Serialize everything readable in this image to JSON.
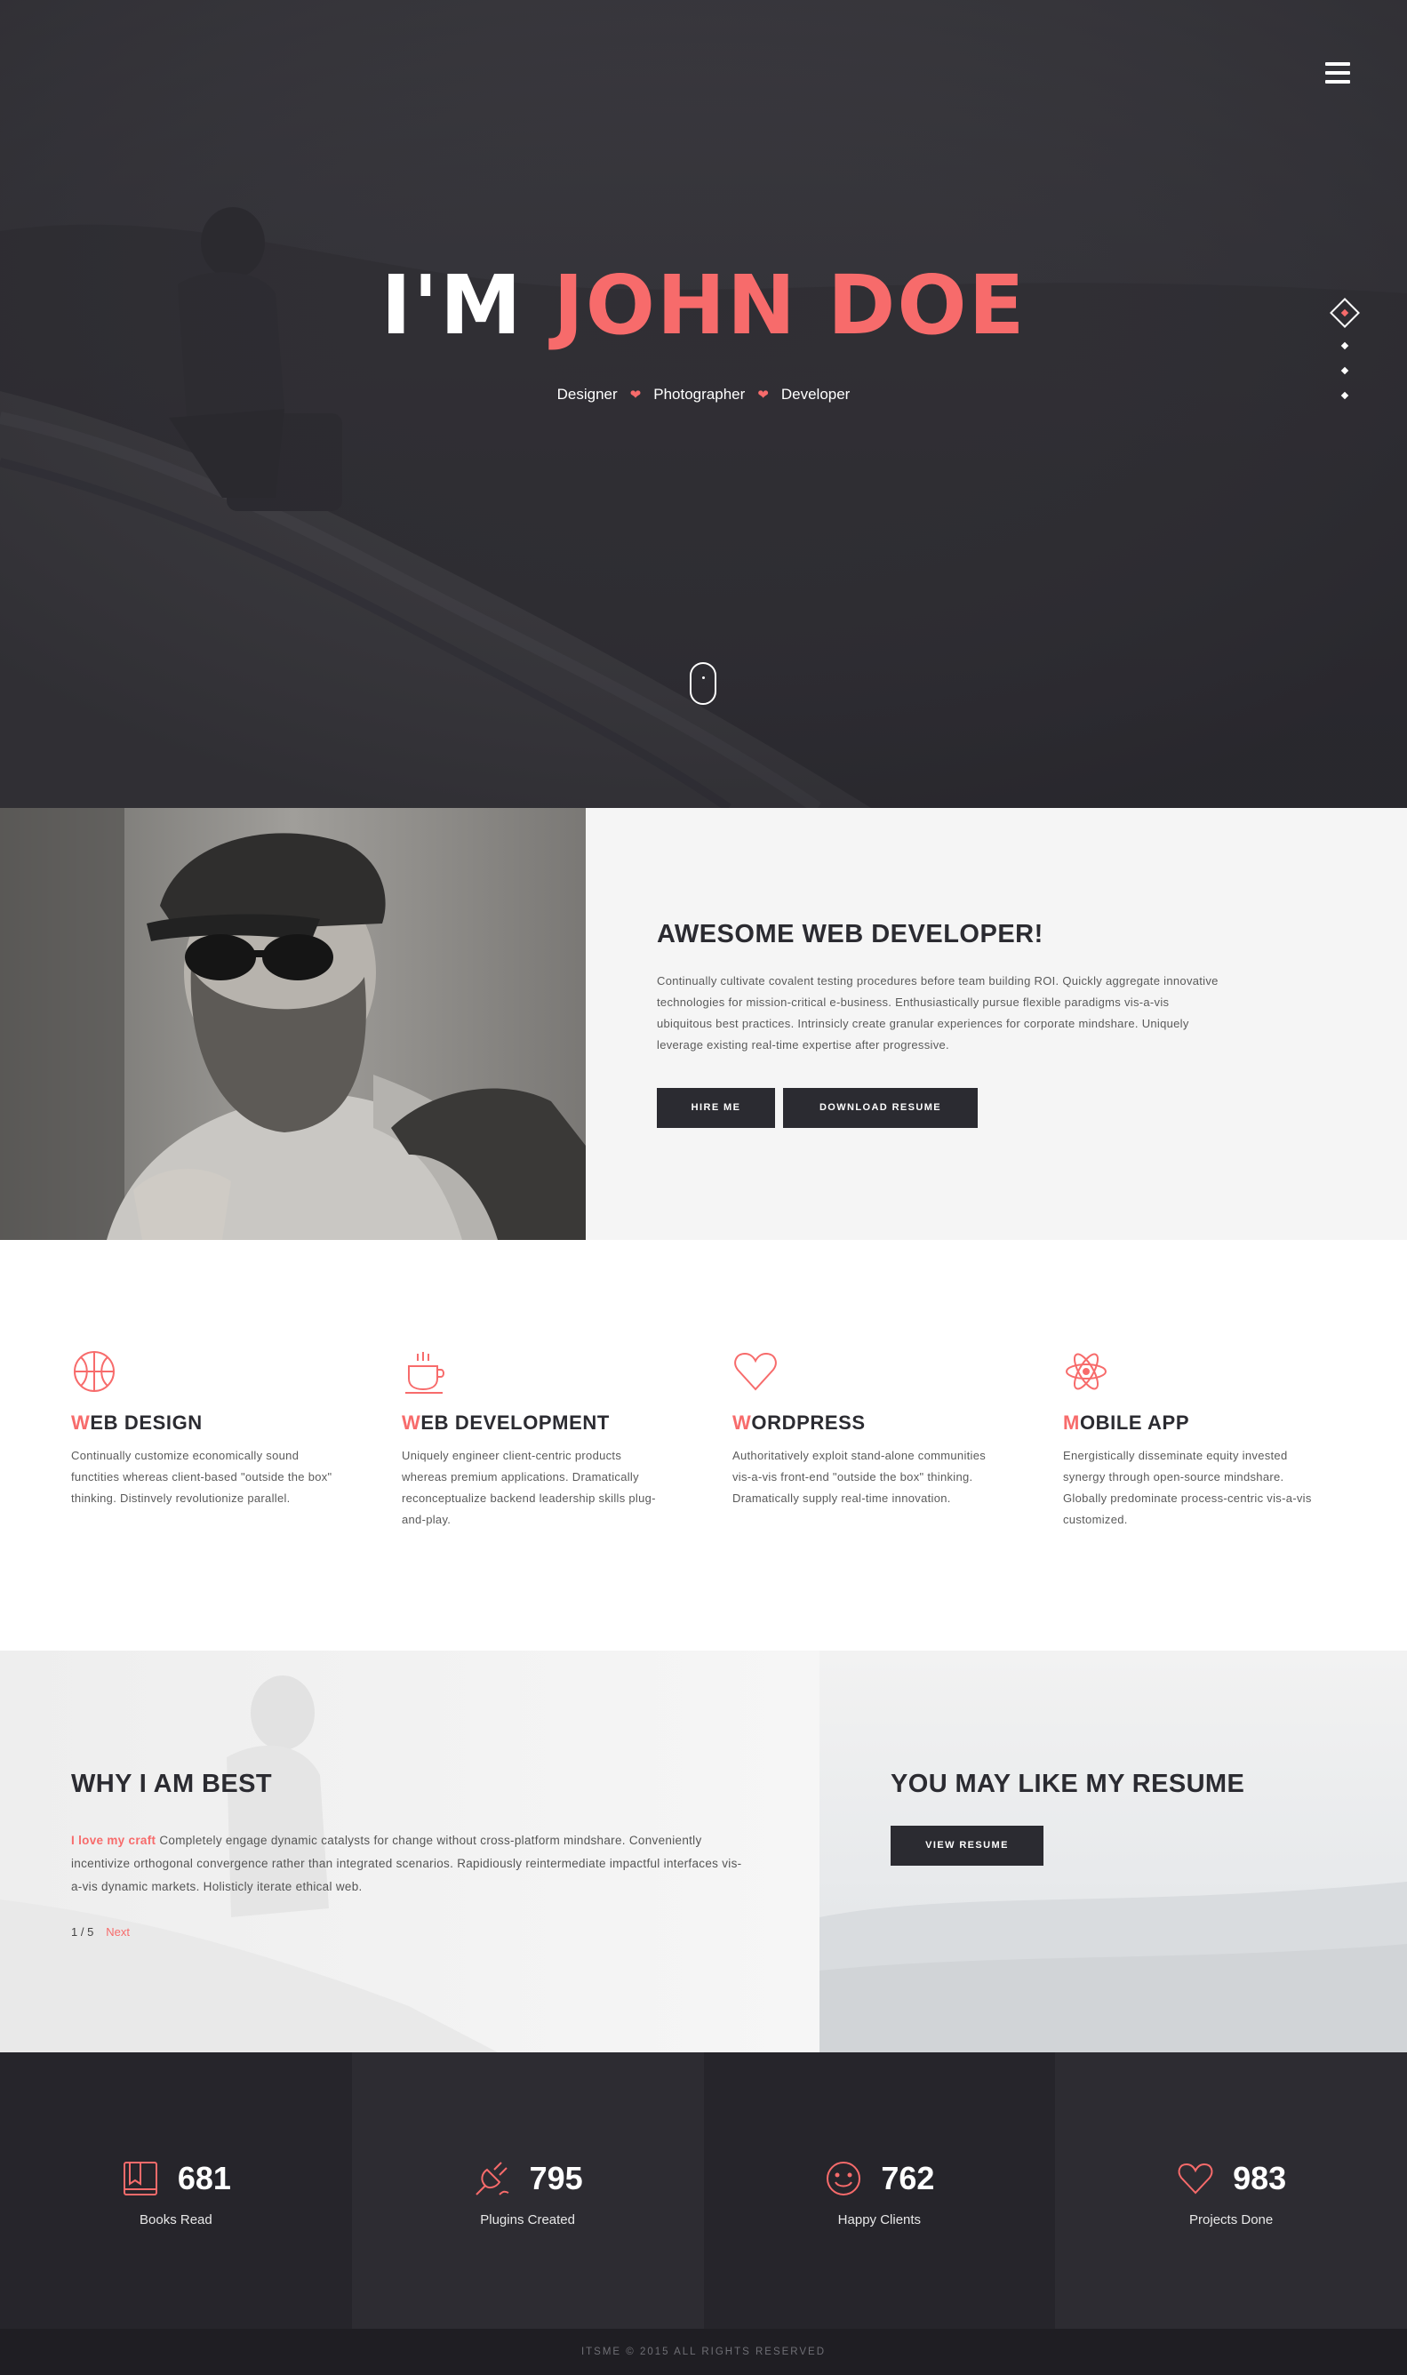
{
  "hero": {
    "title_prefix": "I'M",
    "title_name": "JOHN DOE",
    "roles": [
      "Designer",
      "Photographer",
      "Developer"
    ]
  },
  "about": {
    "heading": "AWESOME WEB DEVELOPER!",
    "body": "Continually cultivate covalent testing procedures before team building ROI. Quickly aggregate innovative technologies for mission-critical e-business. Enthusiastically pursue flexible paradigms vis-a-vis ubiquitous best practices. Intrinsicly create granular experiences for corporate mindshare. Uniquely leverage existing real-time expertise after progressive.",
    "hire_label": "HIRE ME",
    "download_label": "DOWNLOAD RESUME"
  },
  "services": [
    {
      "icon": "basketball-icon",
      "first": "W",
      "rest": "EB DESIGN",
      "text": "Continually customize economically sound functities whereas client-based \"outside the box\" thinking. Distinvely revolutionize parallel."
    },
    {
      "icon": "coffee-cup-icon",
      "first": "W",
      "rest": "EB DEVELOPMENT",
      "text": "Uniquely engineer client-centric products whereas premium applications. Dramatically reconceptualize backend leadership skills plug-and-play."
    },
    {
      "icon": "heart-icon",
      "first": "W",
      "rest": "ORDPRESS",
      "text": "Authoritatively exploit stand-alone communities vis-a-vis front-end \"outside the box\" thinking. Dramatically supply real-time innovation."
    },
    {
      "icon": "atom-icon",
      "first": "M",
      "rest": "OBILE APP",
      "text": "Energistically disseminate equity invested synergy through open-source mindshare. Globally predominate process-centric vis-a-vis customized."
    }
  ],
  "why": {
    "heading": "WHY I AM BEST",
    "lead": "I love my craft",
    "body": " Completely engage dynamic catalysts for change without cross-platform mindshare. Conveniently incentivize orthogonal convergence rather than integrated scenarios. Rapidiously reintermediate impactful interfaces vis-a-vis dynamic markets. Holisticly iterate ethical web.",
    "page": "1 / 5",
    "next_label": "Next"
  },
  "resume": {
    "heading": "YOU MAY LIKE MY RESUME",
    "button_label": "VIEW RESUME"
  },
  "counters": [
    {
      "icon": "book-icon",
      "value": "681",
      "label": "Books Read"
    },
    {
      "icon": "plug-icon",
      "value": "795",
      "label": "Plugins Created"
    },
    {
      "icon": "smile-icon",
      "value": "762",
      "label": "Happy Clients"
    },
    {
      "icon": "heart-icon",
      "value": "983",
      "label": "Projects Done"
    }
  ],
  "footer": {
    "copyright": "ITSME © 2015 ALL RIGHTS RESERVED"
  },
  "colors": {
    "accent": "#f76b6b",
    "dark": "#2b2b31",
    "counter_bg": "#26252b"
  }
}
